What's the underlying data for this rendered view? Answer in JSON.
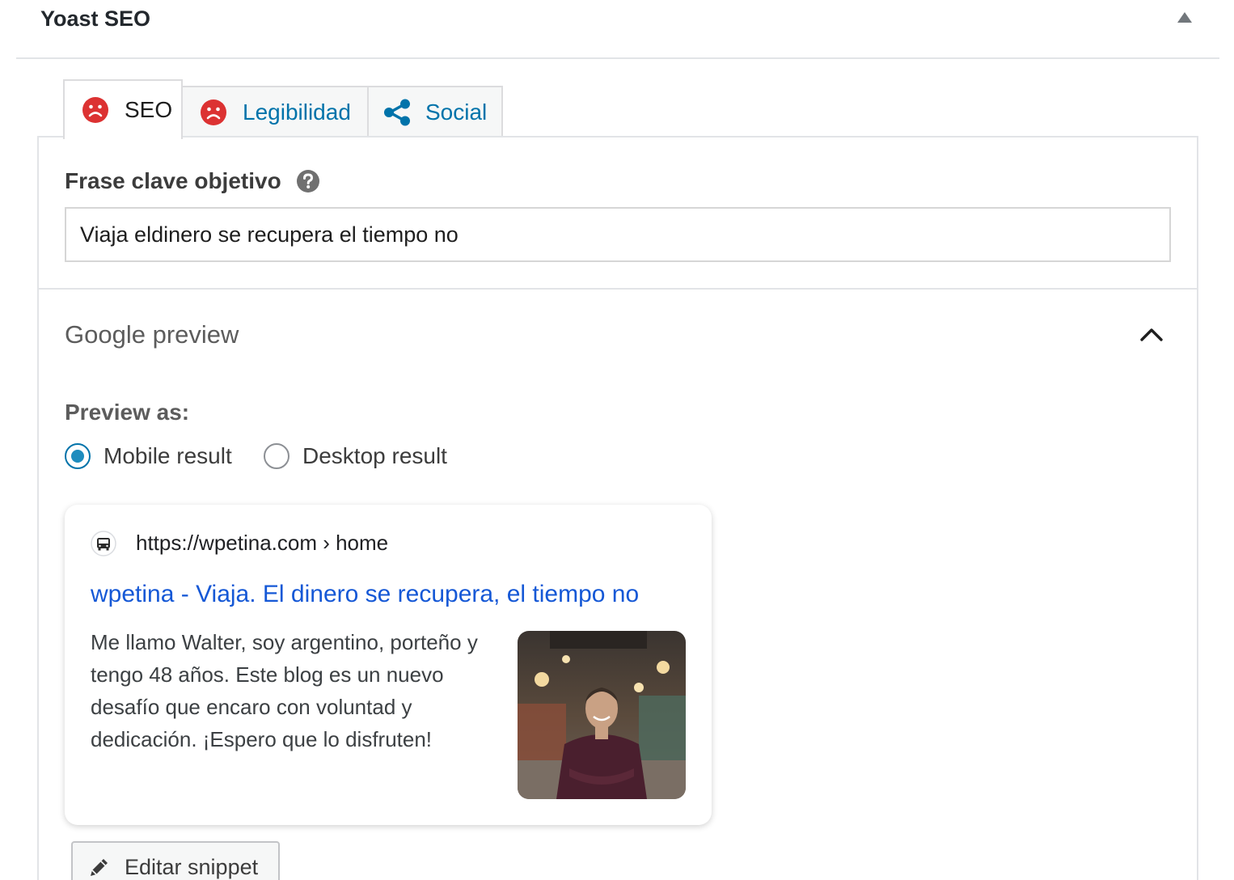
{
  "panel": {
    "title": "Yoast SEO"
  },
  "tabs": [
    {
      "label": "SEO",
      "icon": "sad-face-icon",
      "active": true
    },
    {
      "label": "Legibilidad",
      "icon": "sad-face-icon",
      "active": false
    },
    {
      "label": "Social",
      "icon": "share-icon",
      "active": false
    }
  ],
  "keyphrase": {
    "label": "Frase clave objetivo",
    "value": "Viaja eldinero se recupera el tiempo no"
  },
  "google_preview": {
    "title": "Google preview",
    "preview_as_label": "Preview as:",
    "options": [
      {
        "label": "Mobile result",
        "checked": true
      },
      {
        "label": "Desktop result",
        "checked": false
      }
    ],
    "result": {
      "url": "https://wpetina.com › home",
      "title": "wpetina - Viaja. El dinero se recupera, el tiempo no",
      "description": "Me llamo Walter, soy argentino, porteño y tengo 48 años. Este blog es un nuevo desafío que encaro con voluntad y dedicación. ¡Espero que lo disfruten!"
    },
    "edit_button": "Editar snippet"
  },
  "colors": {
    "link": "#0073aa",
    "result_title": "#1558d6",
    "problem": "#dc3232",
    "radio_checked": "#1e8cbe"
  }
}
